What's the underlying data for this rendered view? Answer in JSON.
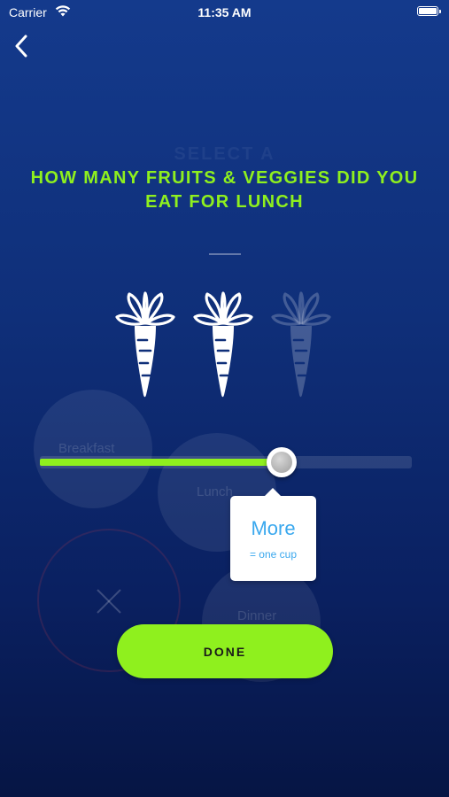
{
  "status_bar": {
    "carrier": "Carrier",
    "time": "11:35 AM"
  },
  "nav": {
    "back_icon": "chevron-left-icon"
  },
  "background_text": {
    "title_line1": "SELECT A",
    "breakfast": "Breakfast",
    "lunch": "Lunch",
    "dinner": "Dinner"
  },
  "question": {
    "title": "HOW MANY FRUITS & VEGGIES DID YOU EAT FOR LUNCH"
  },
  "servings": {
    "icon": "carrot-icon",
    "total": 3,
    "selected": 2
  },
  "slider": {
    "value_fraction": 0.65,
    "active_color": "#8ff01e"
  },
  "tooltip": {
    "label": "More",
    "sub_label": "= one cup",
    "color": "#3aa8ee"
  },
  "done_button": {
    "label": "DONE",
    "color": "#8ff01e"
  },
  "colors": {
    "accent": "#8ff01e",
    "background_top": "#143a8c",
    "background_bottom": "#061544"
  }
}
